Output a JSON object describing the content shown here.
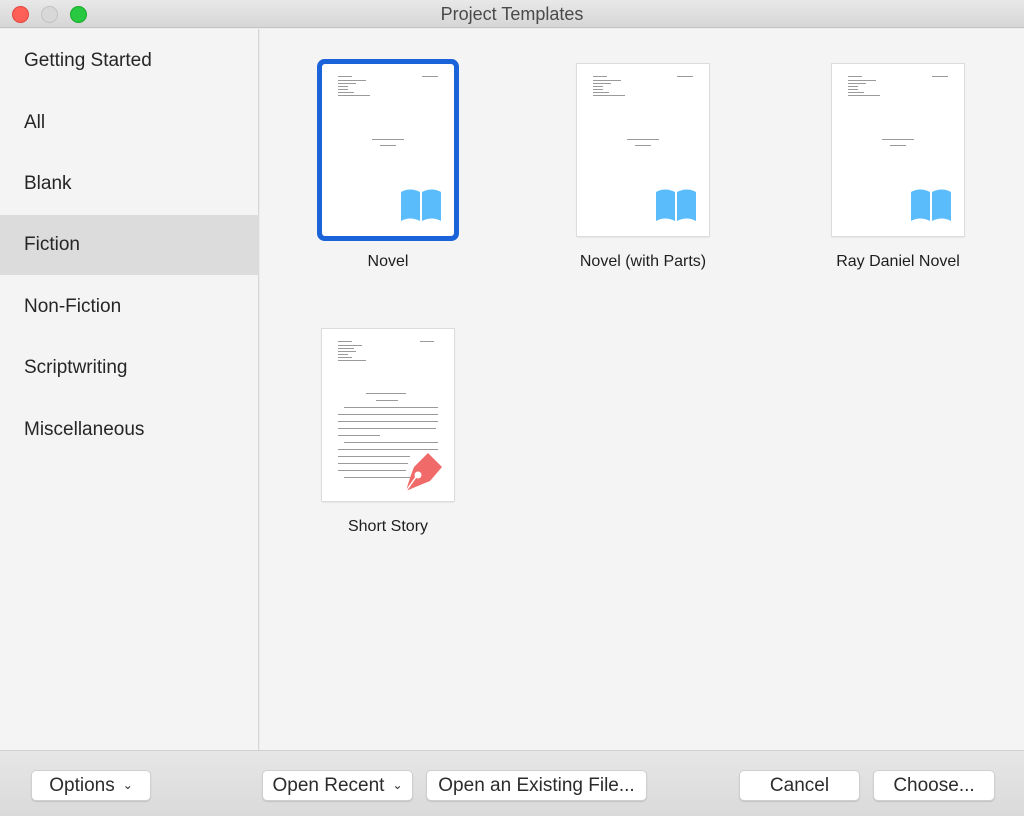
{
  "window": {
    "title": "Project Templates"
  },
  "sidebar": {
    "items": [
      {
        "label": "Getting Started",
        "active": false
      },
      {
        "label": "All",
        "active": false
      },
      {
        "label": "Blank",
        "active": false
      },
      {
        "label": "Fiction",
        "active": true
      },
      {
        "label": "Non-Fiction",
        "active": false
      },
      {
        "label": "Scriptwriting",
        "active": false
      },
      {
        "label": "Miscellaneous",
        "active": false
      }
    ]
  },
  "templates": [
    {
      "label": "Novel",
      "icon": "open-book-icon",
      "selected": true
    },
    {
      "label": "Novel (with Parts)",
      "icon": "open-book-icon",
      "selected": false
    },
    {
      "label": "Ray Daniel Novel",
      "icon": "open-book-icon",
      "selected": false
    },
    {
      "label": "Short Story",
      "icon": "fountain-pen-nib-icon",
      "selected": false
    }
  ],
  "footer": {
    "options_label": "Options",
    "open_recent_label": "Open Recent",
    "open_existing_label": "Open an Existing File...",
    "cancel_label": "Cancel",
    "choose_label": "Choose..."
  },
  "colors": {
    "selection": "#1a63d9",
    "book_icon": "#5bbcfb",
    "pen_icon": "#f06a6a"
  }
}
